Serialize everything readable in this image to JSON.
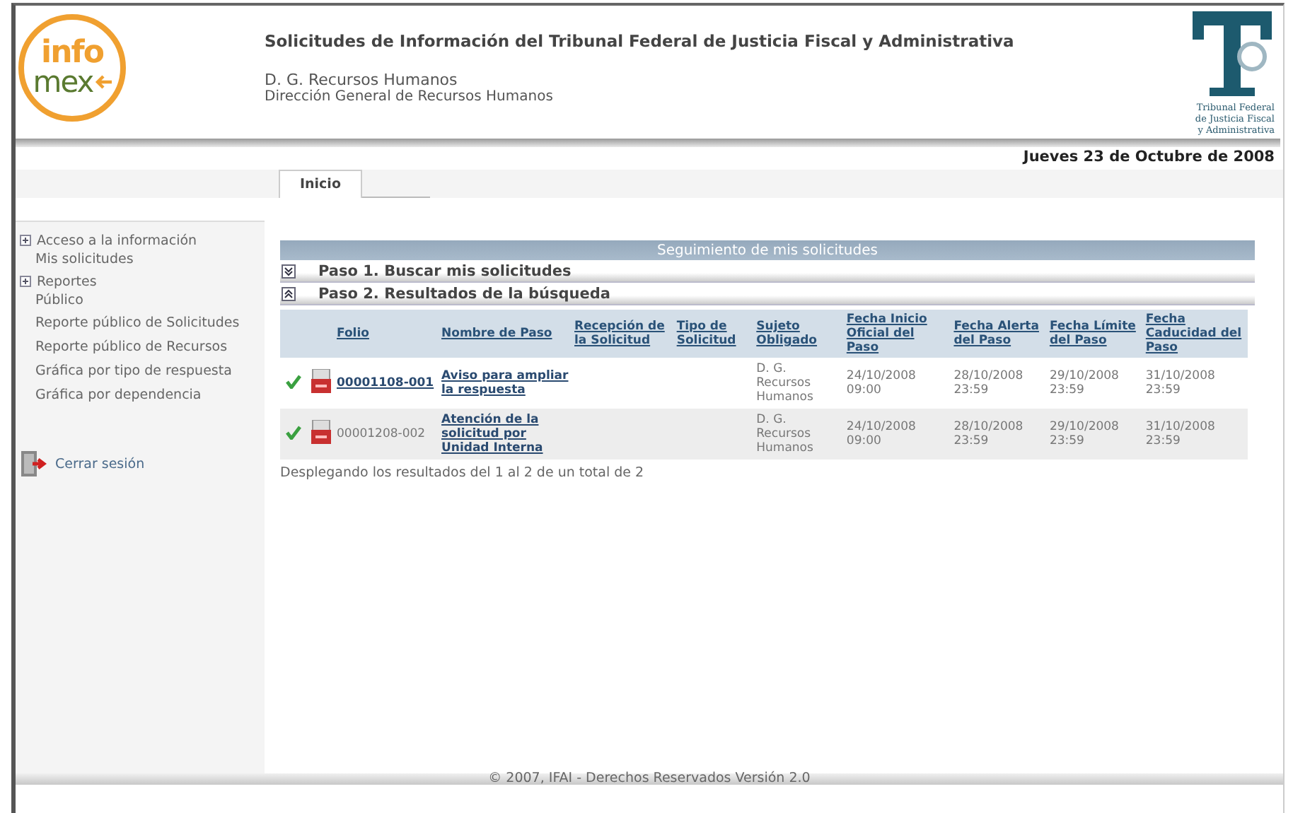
{
  "header": {
    "logo": {
      "top": "info",
      "bottom": "mex"
    },
    "title": "Solicitudes de Información del Tribunal Federal de Justicia Fiscal y Administrativa",
    "unit_short": "D. G. Recursos Humanos",
    "unit_long": "Dirección General de Recursos Humanos",
    "emblem_caption": [
      "Tribunal Federal",
      "de Justicia Fiscal",
      "y Administrativa"
    ]
  },
  "date": "Jueves 23 de Octubre de 2008",
  "tabs": [
    {
      "label": "Inicio",
      "selected": true
    }
  ],
  "sidebar": {
    "items": [
      {
        "label": "Acceso a la información",
        "kind": "section",
        "children": [
          {
            "label": "Mis solicitudes",
            "kind": "link"
          }
        ]
      },
      {
        "label": "Reportes",
        "kind": "section",
        "children": [
          {
            "label": "Público",
            "kind": "link"
          },
          {
            "label": "Reporte público de Solicitudes",
            "kind": "link"
          },
          {
            "label": "Reporte público de Recursos",
            "kind": "link"
          },
          {
            "label": "Gráfica por tipo de respuesta",
            "kind": "link"
          },
          {
            "label": "Gráfica por dependencia",
            "kind": "link"
          }
        ]
      }
    ],
    "logout": "Cerrar sesión"
  },
  "panel_title": "Seguimiento de mis solicitudes",
  "steps": [
    {
      "label": "Paso 1. Buscar mis solicitudes",
      "expanded": false
    },
    {
      "label": "Paso 2. Resultados de la búsqueda",
      "expanded": true
    }
  ],
  "table": {
    "columns": [
      "Folio",
      "Nombre de Paso",
      "Recepción de la Solicitud",
      "Tipo de Solicitud",
      "Sujeto Obligado",
      "Fecha Inicio Oficial del Paso",
      "Fecha Alerta del Paso",
      "Fecha Límite del Paso",
      "Fecha Caducidad del Paso"
    ],
    "rows": [
      {
        "folio": "00001108-001",
        "folio_link": true,
        "paso": "Aviso para ampliar la respuesta",
        "sujeto": "D. G. Recursos Humanos",
        "inicio": "24/10/2008 09:00",
        "alerta": "28/10/2008 23:59",
        "limite": "29/10/2008 23:59",
        "caducidad": "31/10/2008 23:59"
      },
      {
        "folio": "00001208-002",
        "folio_link": false,
        "paso": "Atención de la solicitud por Unidad Interna",
        "sujeto": "D. G. Recursos Humanos",
        "inicio": "24/10/2008 09:00",
        "alerta": "28/10/2008 23:59",
        "limite": "29/10/2008 23:59",
        "caducidad": "31/10/2008 23:59"
      }
    ]
  },
  "results_note": "Desplegando los resultados del 1 al 2 de un total de 2",
  "footer": "© 2007, IFAI - Derechos Reservados Versión 2.0"
}
